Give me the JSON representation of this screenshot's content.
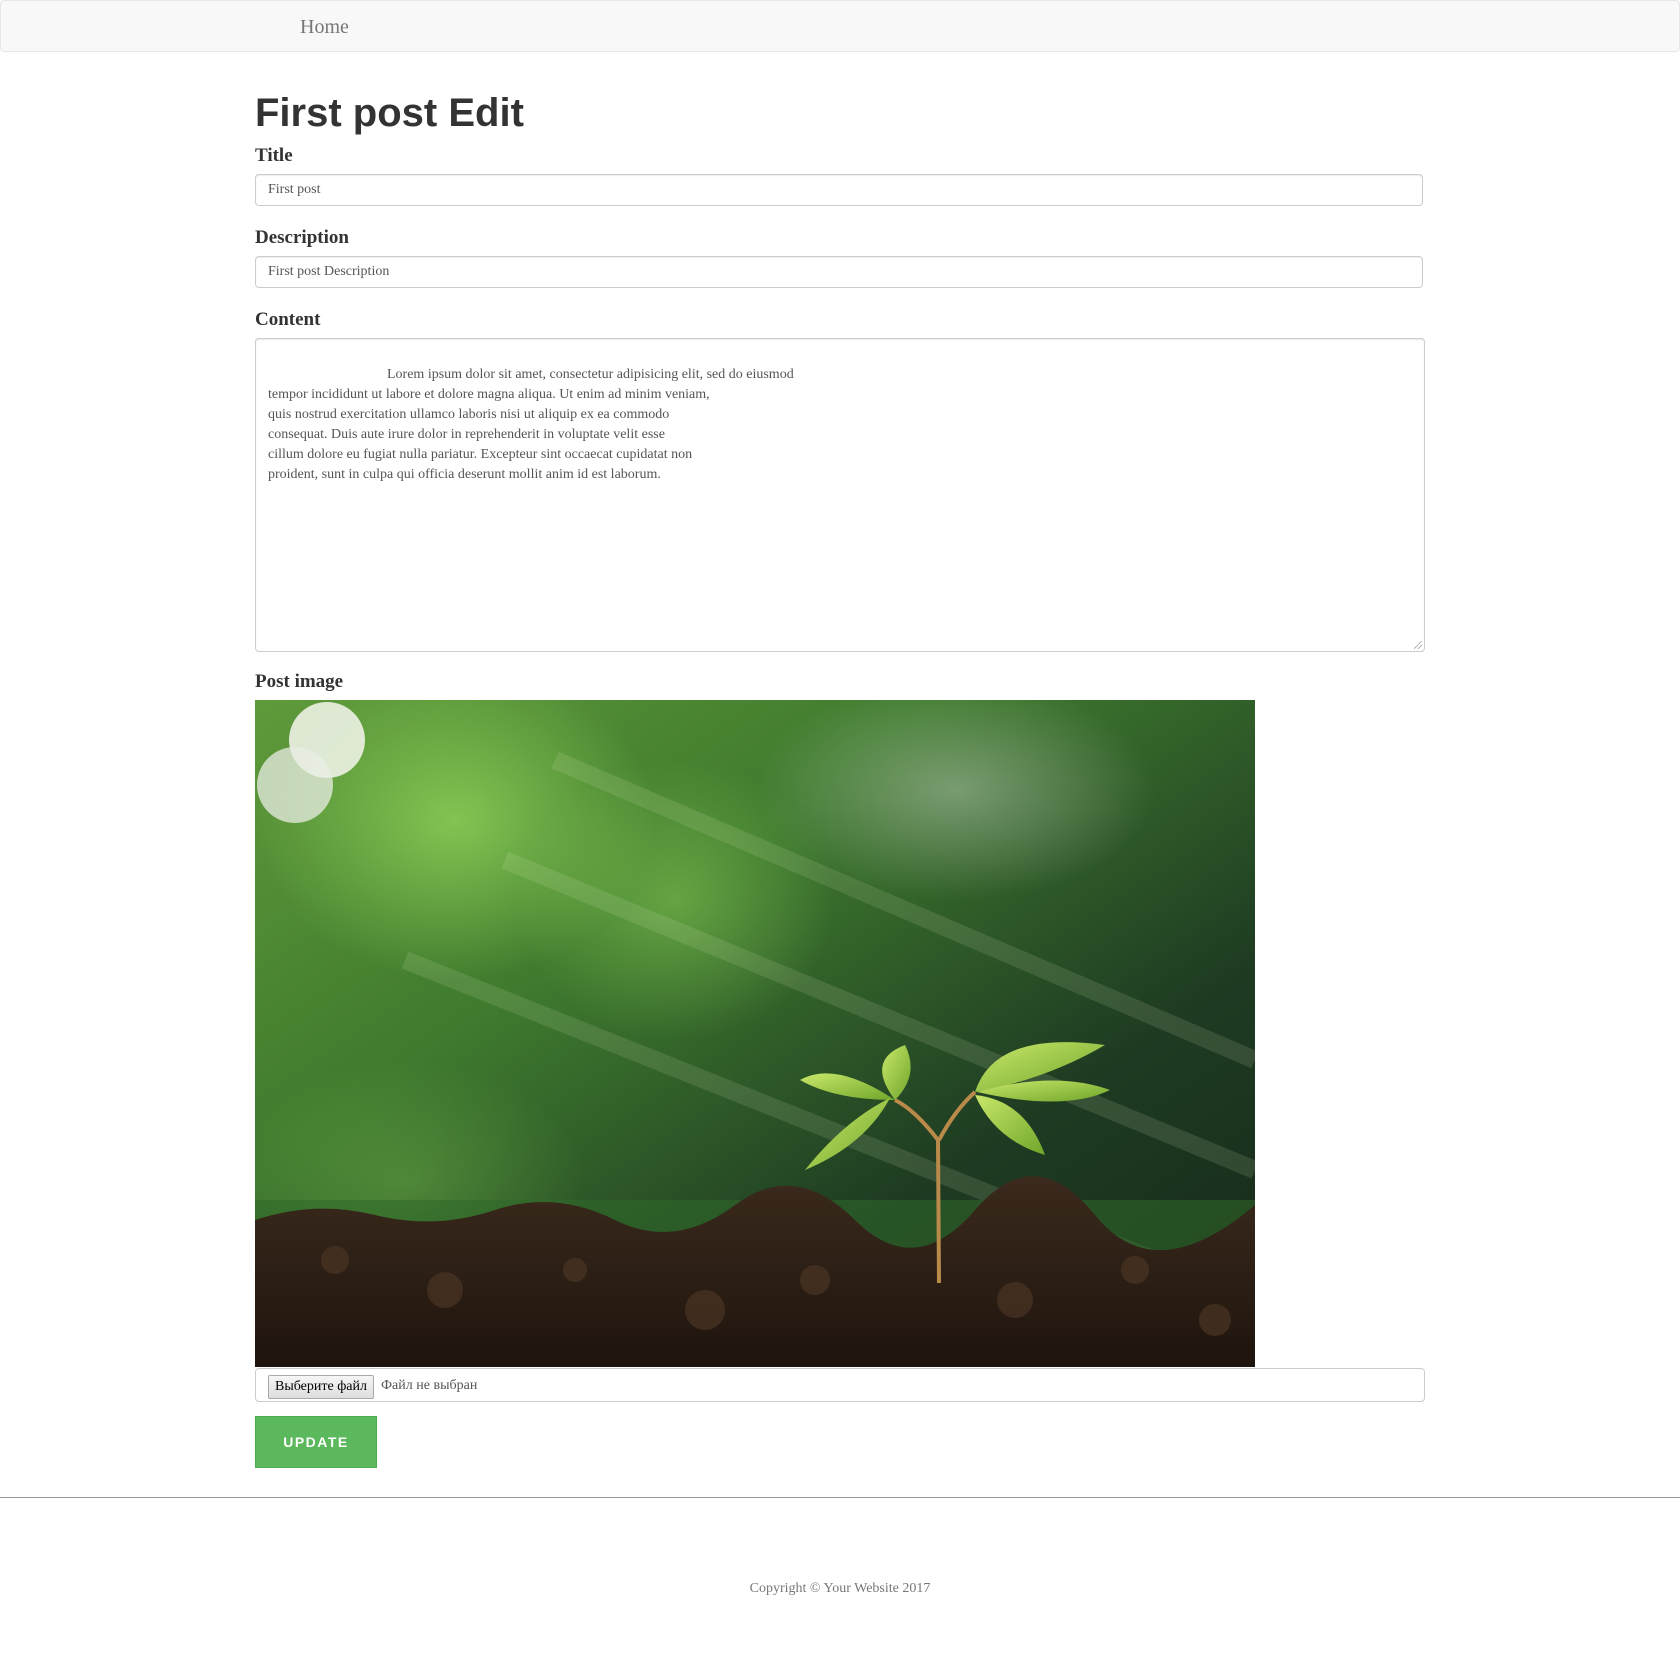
{
  "navbar": {
    "home_label": "Home"
  },
  "page": {
    "title": "First post Edit"
  },
  "form": {
    "title_label": "Title",
    "title_value": "First post",
    "description_label": "Description",
    "description_value": "First post Description",
    "content_label": "Content",
    "content_value": "                              Lorem ipsum dolor sit amet, consectetur adipisicing elit, sed do eiusmod\ntempor incididunt ut labore et dolore magna aliqua. Ut enim ad minim veniam,\nquis nostrud exercitation ullamco laboris nisi ut aliquip ex ea commodo\nconsequat. Duis aute irure dolor in reprehenderit in voluptate velit esse\ncillum dolore eu fugiat nulla pariatur. Excepteur sint occaecat cupidatat non\nproident, sunt in culpa qui officia deserunt mollit anim id est laborum.",
    "image_label": "Post image",
    "file_button_label": "Выберите файл",
    "file_status": "Файл не выбран",
    "update_label": "UPDATE"
  },
  "footer": {
    "copyright": "Copyright © Your Website 2017"
  },
  "colors": {
    "accent_green": "#5cb85c",
    "navbar_bg": "#f8f8f8"
  }
}
